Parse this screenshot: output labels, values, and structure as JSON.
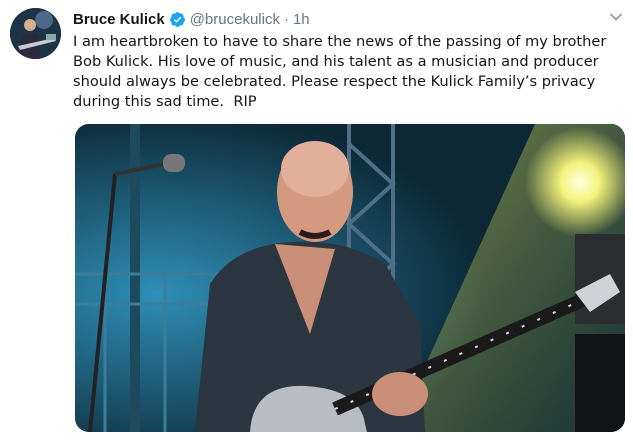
{
  "tweet": {
    "author": {
      "display_name": "Bruce Kulick",
      "handle": "@brucekulick",
      "verified": true,
      "avatar_icon": "guitarist-avatar"
    },
    "separator": "·",
    "time": "1h",
    "text": "I am heartbroken to have to share the news of the passing of my brother\nBob Kulick. His love of music, and his talent as a musician and producer\nshould always be celebrated. Please respect the Kulick Family’s privacy\nduring this sad time.  RIP",
    "media": {
      "type": "photo",
      "subject_icon": "guitarist-on-stage-photo"
    }
  },
  "colors": {
    "text": "#14171a",
    "secondary": "#657786",
    "verified": "#1da1f2"
  },
  "icons": {
    "verified": "verified-badge-icon",
    "menu": "chevron-down-icon"
  }
}
